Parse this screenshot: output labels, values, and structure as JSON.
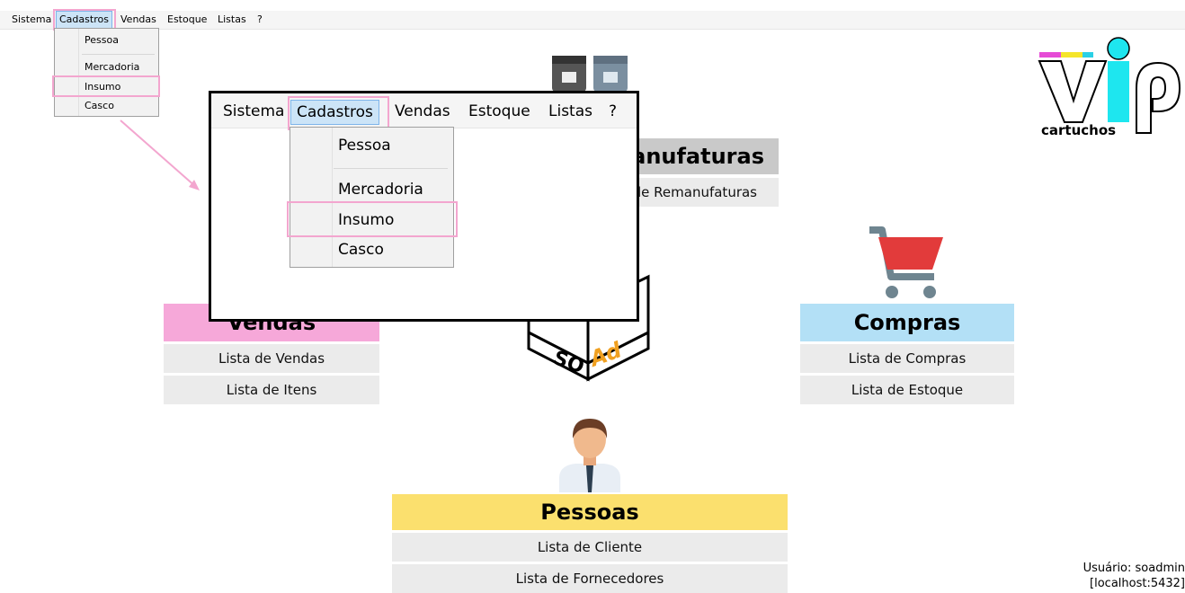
{
  "menu": {
    "items": [
      "Sistema",
      "Cadastros",
      "Vendas",
      "Estoque",
      "Listas",
      "?"
    ]
  },
  "cadastros_menu": {
    "items": [
      "Pessoa",
      "Mercadoria",
      "Insumo",
      "Casco"
    ]
  },
  "sections": {
    "remanufaturas": {
      "title": "Remanufaturas",
      "visible_title": "manufaturas",
      "link": "Lista de Remanufaturas",
      "visible_link": "a de Remanufaturas"
    },
    "vendas": {
      "title": "Vendas",
      "links": [
        "Lista de Vendas",
        "Lista de Itens"
      ]
    },
    "compras": {
      "title": "Compras",
      "links": [
        "Lista de Compras",
        "Lista de Estoque"
      ]
    },
    "pessoas": {
      "title": "Pessoas",
      "links": [
        "Lista de Cliente",
        "Lista de Fornecedores"
      ]
    }
  },
  "center_logo": {
    "left": "SO",
    "right": "Ad"
  },
  "brand": {
    "name": "cartuchos"
  },
  "status": {
    "user": "Usuário: soadmin",
    "connection": "[localhost:5432]"
  },
  "colors": {
    "vendas": "#f6a8d9",
    "compras": "#b3e0f6",
    "pessoas": "#fbe06e",
    "remanufaturas": "#c9c9c9",
    "highlight": "#f3a6cf",
    "menu_active": "#cce4f7"
  }
}
